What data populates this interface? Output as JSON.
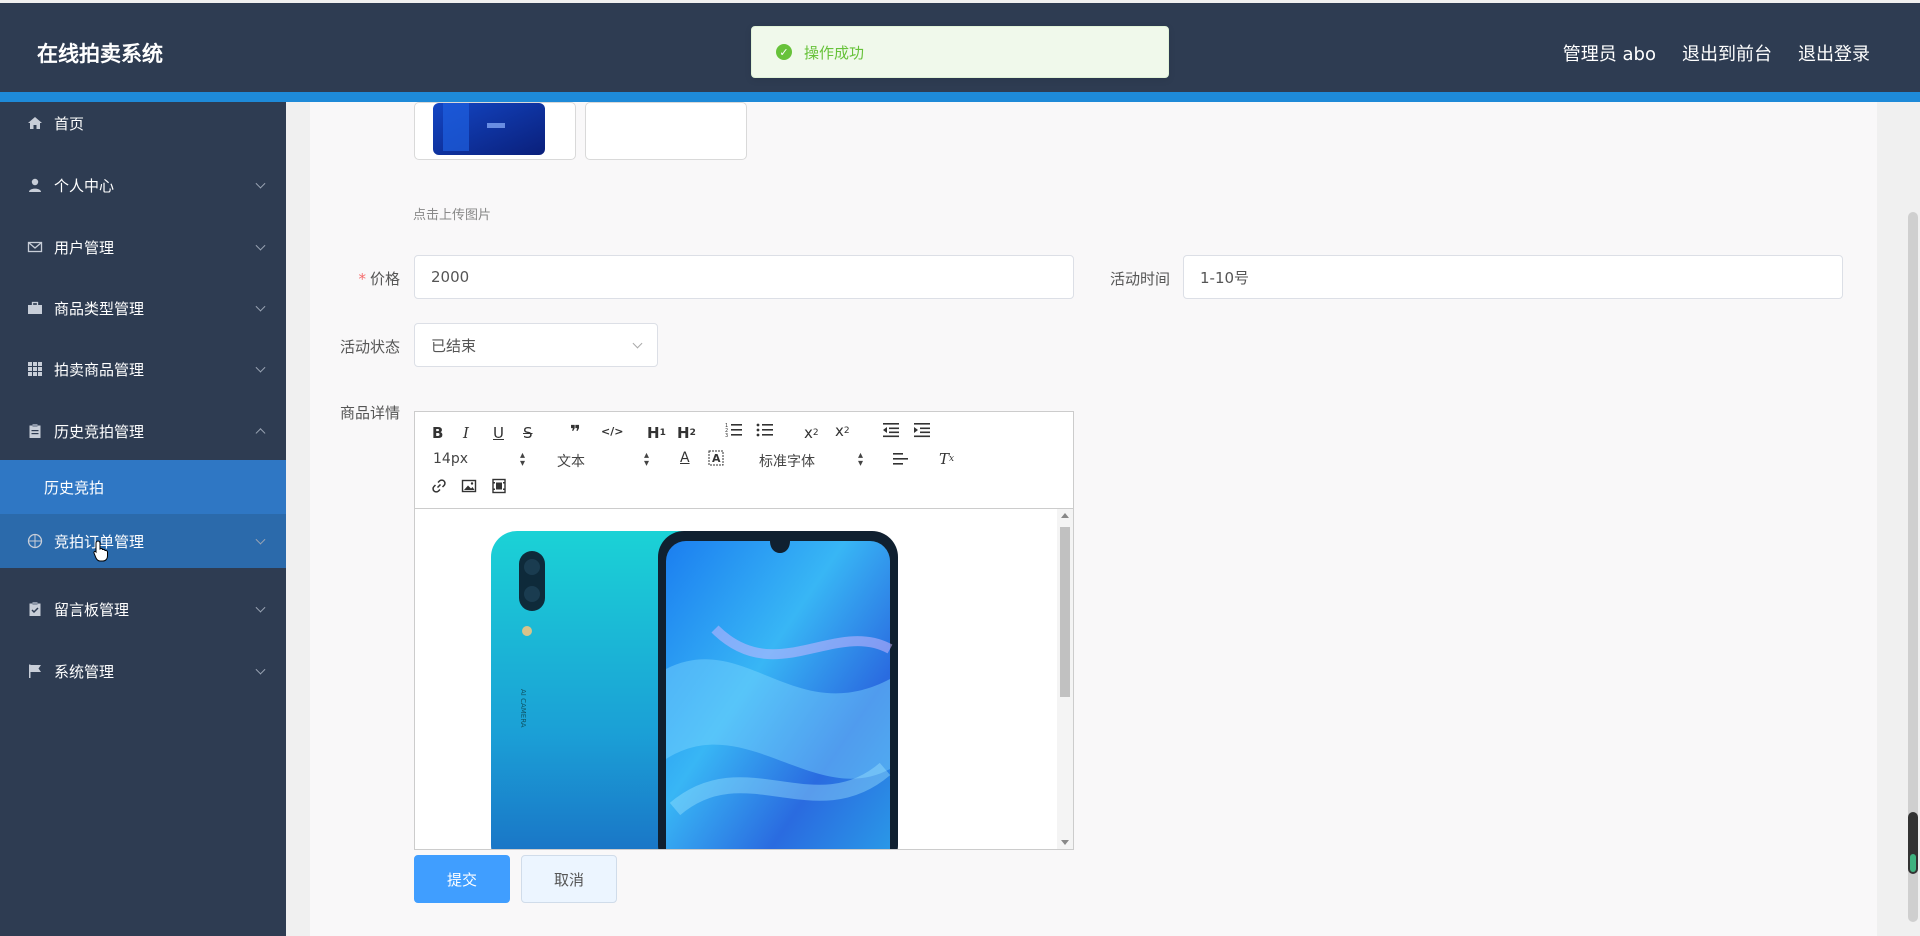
{
  "header": {
    "title": "在线拍卖系统",
    "user": "管理员 abo",
    "to_front": "退出到前台",
    "logout": "退出登录"
  },
  "toast": {
    "message": "操作成功"
  },
  "sidebar": {
    "items": [
      {
        "label": "首页",
        "icon": "home-icon"
      },
      {
        "label": "个人中心",
        "icon": "user-icon"
      },
      {
        "label": "用户管理",
        "icon": "mail-icon"
      },
      {
        "label": "商品类型管理",
        "icon": "briefcase-icon"
      },
      {
        "label": "拍卖商品管理",
        "icon": "grid-icon"
      },
      {
        "label": "历史竞拍管理",
        "icon": "clipboard-icon"
      },
      {
        "label": "竞拍订单管理",
        "icon": "compass-icon"
      },
      {
        "label": "留言板管理",
        "icon": "clipboard-check-icon"
      },
      {
        "label": "系统管理",
        "icon": "flag-icon"
      }
    ],
    "submenu_active": "历史竞拍"
  },
  "form": {
    "upload_hint": "点击上传图片",
    "price_label": "价格",
    "price_value": "2000",
    "time_label": "活动时间",
    "time_value": "1-10号",
    "status_label": "活动状态",
    "status_value": "已结束",
    "detail_label": "商品详情"
  },
  "editor": {
    "font_size": "14px",
    "text_type": "文本",
    "font_family": "标准字体"
  },
  "buttons": {
    "submit": "提交",
    "cancel": "取消"
  },
  "colors": {
    "header_bg": "#2e3c52",
    "accent": "#1e8ad8",
    "primary": "#409eff",
    "success": "#67c23a"
  }
}
